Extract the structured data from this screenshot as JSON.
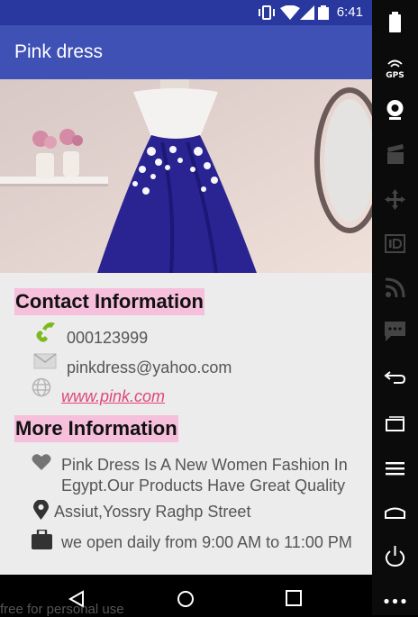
{
  "status_bar": {
    "time": "6:41"
  },
  "app_bar": {
    "title": "Pink dress"
  },
  "contact": {
    "heading": "Contact Information",
    "phone": "000123999",
    "email": "pinkdress@yahoo.com",
    "website": "www.pink.com"
  },
  "more": {
    "heading": "More Information",
    "description": "Pink Dress Is A New Women Fashion In Egypt.Our Products Have Great Quality",
    "address": "Assiut,Yossry Raghp Street",
    "hours": "we open daily from 9:00 AM to 11:00 PM"
  },
  "emulator": {
    "gps_label": "GPS"
  },
  "watermark": "free for personal use",
  "colors": {
    "status_bar": "#28389e",
    "app_bar": "#3f51b5",
    "section_highlight": "#f6bfdc",
    "link": "#e0457b",
    "phone_icon": "#7cb91b"
  }
}
